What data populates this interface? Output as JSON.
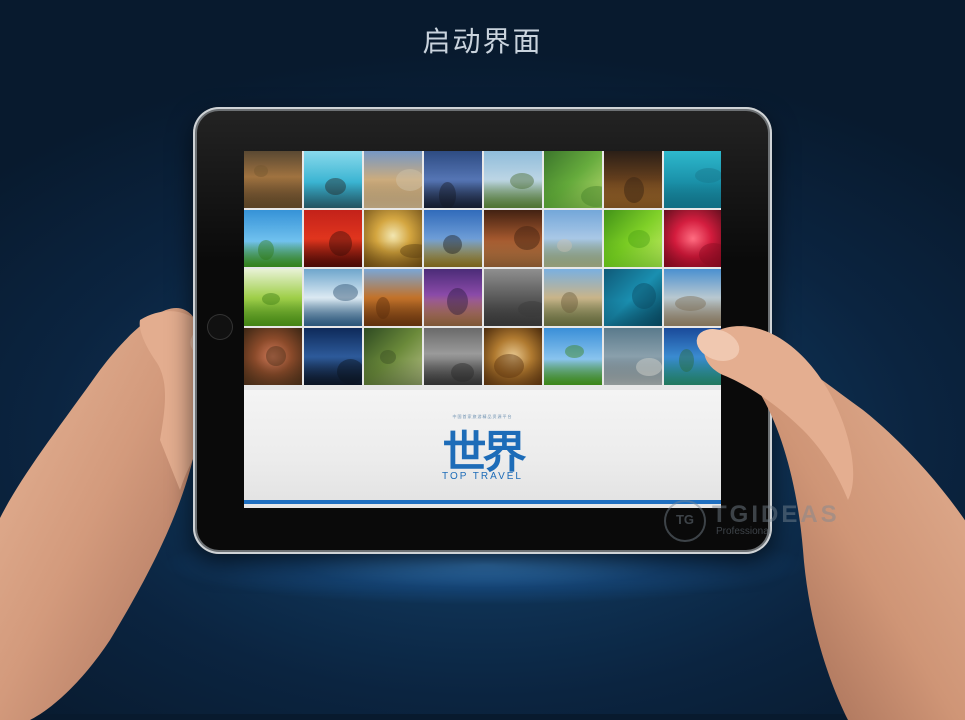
{
  "page_title": "启动界面",
  "app": {
    "tagline": "中国首家旅游精品资源平台",
    "logo_cn": "世界",
    "logo_en": "TOP TRAVEL"
  },
  "watermark": {
    "mark": "TG",
    "text": "TGIDEAS",
    "sub": "Professional"
  },
  "colors": {
    "accent_blue": "#1f6fc0",
    "background": "#0b2440"
  },
  "photos": [
    {
      "name": "castle-walls-photo",
      "bg": "linear-gradient(180deg,#4d3a22 0%,#9a6a34 45%,#3a2a18 100%)",
      "ov": "#6b4c22"
    },
    {
      "name": "beach-couple-photo",
      "bg": "linear-gradient(180deg,#7fd6ea 0%,#2fb0d0 55%,#1d8aa8 100%)",
      "ov": "#1b1b1b"
    },
    {
      "name": "plaza-building-photo",
      "bg": "linear-gradient(180deg,#6a8fc0 0%,#c9a776 50%,#8b6b3d 100%)",
      "ov": "#cfc2a6"
    },
    {
      "name": "coast-dusk-photo",
      "bg": "linear-gradient(180deg,#1d3d78 0%,#4b6db0 50%,#0e1a33 100%)",
      "ov": "#0a0f1c"
    },
    {
      "name": "tree-field-photo",
      "bg": "linear-gradient(180deg,#86b7d8 0%,#b8d3e3 50%,#557d32 100%)",
      "ov": "#3d6122"
    },
    {
      "name": "chameleon-photo",
      "bg": "linear-gradient(135deg,#2c6b1b 0%,#5ca630 50%,#b9d96a 100%)",
      "ov": "#3b7d20"
    },
    {
      "name": "candles-photo",
      "bg": "linear-gradient(180deg,#1a0d04 0%,#5c3410 50%,#c4802a 100%)",
      "ov": "#2a1606"
    },
    {
      "name": "underwater-turtle-photo",
      "bg": "linear-gradient(180deg,#1db3c9 0%,#0d8aa3 55%,#066276 100%)",
      "ov": "#0a6f86"
    },
    {
      "name": "cloud-tree-photo",
      "bg": "linear-gradient(180deg,#2f8fd6 0%,#6fc1ef 55%,#3b8a1e 100%)",
      "ov": "#2e7a19"
    },
    {
      "name": "red-umbrella-photo",
      "bg": "linear-gradient(180deg,#c11a12 0%,#e0321a 50%,#5a0c06 100%)",
      "ov": "#3a0a06"
    },
    {
      "name": "dandelion-photo",
      "bg": "radial-gradient(circle at 50% 45%,#f2e6b0 0%,#d3a43c 40%,#6b4a12 100%)",
      "ov": "#5a3e10"
    },
    {
      "name": "road-sign-photo",
      "bg": "linear-gradient(180deg,#2a66b8 0%,#6b9bd6 50%,#e6b820 100%)",
      "ov": "#1a1a1a"
    },
    {
      "name": "arches-photo",
      "bg": "linear-gradient(180deg,#3c1a0a 0%,#a0542a 50%,#d89a5a 100%)",
      "ov": "#3a1a0a"
    },
    {
      "name": "castle-photo",
      "bg": "linear-gradient(180deg,#6fa4d8 0%,#a8c7e6 50%,#4f6b2c 100%)",
      "ov": "#c7c2b4"
    },
    {
      "name": "frog-leaf-photo",
      "bg": "linear-gradient(135deg,#3b8f10 0%,#7ccf22 50%,#c8ec6a 100%)",
      "ov": "#4aa012"
    },
    {
      "name": "red-flower-photo",
      "bg": "radial-gradient(circle at 50% 50%,#ff6b7f 0%,#d3183a 45%,#5e0616 100%)",
      "ov": "#8a0c22"
    },
    {
      "name": "sprout-photo",
      "bg": "linear-gradient(180deg,#e8f2d6 0%,#9fcf4a 50%,#4a8a18 100%)",
      "ov": "#3f7f14"
    },
    {
      "name": "wave-splash-photo",
      "bg": "linear-gradient(180deg,#6ea6cc 0%,#dbe9f2 50%,#2d5f86 100%)",
      "ov": "#2a4e6e"
    },
    {
      "name": "rock-formation-photo",
      "bg": "linear-gradient(180deg,#7aa6d6 0%,#c2722a 50%,#6a3810 100%)",
      "ov": "#5a2c0c"
    },
    {
      "name": "city-night-bridge-photo",
      "bg": "linear-gradient(180deg,#4b2c78 0%,#8a4aa8 45%,#e2a030 100%)",
      "ov": "#2a1a3e"
    },
    {
      "name": "plant-rock-photo",
      "bg": "linear-gradient(180deg,#8f8f8f 0%,#5a5a5a 50%,#2e2e2e 100%)",
      "ov": "#3a3a3a"
    },
    {
      "name": "monastery-photo",
      "bg": "linear-gradient(180deg,#7ab0e0 0%,#c9b48a 50%,#55703a 100%)",
      "ov": "#6a5a3a"
    },
    {
      "name": "water-drops-photo",
      "bg": "linear-gradient(135deg,#0f5a78 0%,#1a8fb0 50%,#063a4e 100%)",
      "ov": "#0a4a62"
    },
    {
      "name": "climber-photo",
      "bg": "linear-gradient(180deg,#4a90d0 0%,#b8c8d0 50%,#8a7a62 100%)",
      "ov": "#7a6a52"
    },
    {
      "name": "anemone-photo",
      "bg": "radial-gradient(circle at 50% 50%,#d07a5a 0%,#8a4a2a 45%,#3a2614 100%)",
      "ov": "#4a2e18"
    },
    {
      "name": "city-skyline-photo",
      "bg": "linear-gradient(180deg,#0e2a5a 0%,#2d5a9a 50%,#0a1426 100%)",
      "ov": "#0c1420"
    },
    {
      "name": "dragonfly-photo",
      "bg": "linear-gradient(135deg,#2e4a22 0%,#6b8a3a 50%,#b8c08a 100%)",
      "ov": "#3a4e24"
    },
    {
      "name": "wheat-field-photo",
      "bg": "linear-gradient(180deg,#6a6a6a 0%,#9a9a9a 45%,#3a3a3a 100%)",
      "ov": "#2a2a2a"
    },
    {
      "name": "compass-photo",
      "bg": "radial-gradient(circle at 50% 50%,#e8c890 0%,#b07a30 45%,#4a2a0c 100%)",
      "ov": "#5a3410"
    },
    {
      "name": "cloud-meadow-photo",
      "bg": "linear-gradient(180deg,#3a8fd8 0%,#8ac4ee 55%,#3f8a1a 100%)",
      "ov": "#3a8218"
    },
    {
      "name": "seal-photo",
      "bg": "linear-gradient(180deg,#5a7a8c 0%,#8aa0ac 50%,#3a4a54 100%)",
      "ov": "#d8d8d0"
    },
    {
      "name": "tropical-coast-photo",
      "bg": "linear-gradient(180deg,#1a4a9a 0%,#3a8ad0 50%,#1a8a8a 100%)",
      "ov": "#2a6a3a"
    }
  ]
}
